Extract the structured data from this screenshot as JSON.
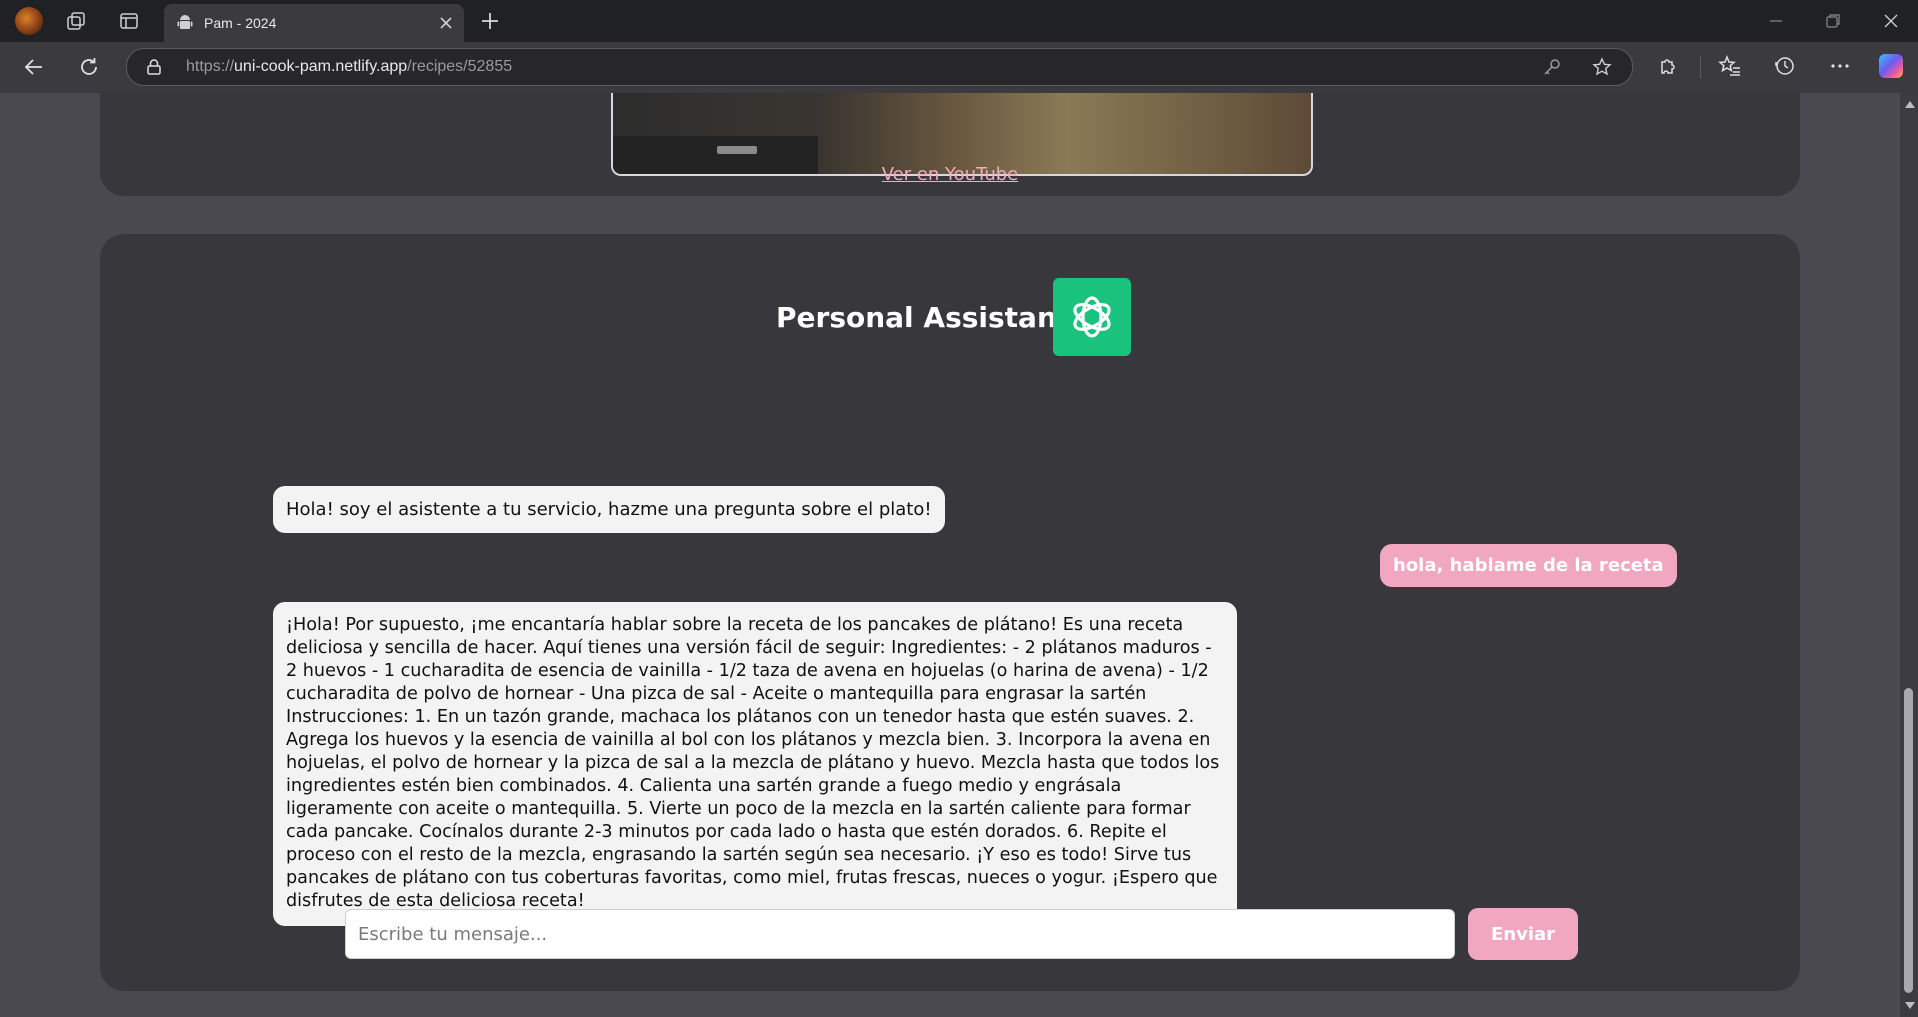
{
  "browser": {
    "tab_title": "Pam - 2024",
    "url_scheme": "https://",
    "url_host": "uni-cook-pam.netlify.app",
    "url_path": "/recipes/52855"
  },
  "video": {
    "youtube_link": "Ver en YouTube"
  },
  "chat": {
    "title": "Personal Assistant",
    "messages": [
      {
        "role": "assistant",
        "text": "Hola! soy el asistente a tu servicio, hazme una pregunta sobre el plato!"
      },
      {
        "role": "user",
        "text": "hola, hablame de la receta"
      },
      {
        "role": "assistant",
        "text": "¡Hola! Por supuesto, ¡me encantaría hablar sobre la receta de los pancakes de plátano! Es una receta deliciosa y sencilla de hacer. Aquí tienes una versión fácil de seguir: Ingredientes: - 2 plátanos maduros - 2 huevos - 1 cucharadita de esencia de vainilla - 1/2 taza de avena en hojuelas (o harina de avena) - 1/2 cucharadita de polvo de hornear - Una pizca de sal - Aceite o mantequilla para engrasar la sartén Instrucciones: 1. En un tazón grande, machaca los plátanos con un tenedor hasta que estén suaves. 2. Agrega los huevos y la esencia de vainilla al bol con los plátanos y mezcla bien. 3. Incorpora la avena en hojuelas, el polvo de hornear y la pizca de sal a la mezcla de plátano y huevo. Mezcla hasta que todos los ingredientes estén bien combinados. 4. Calienta una sartén grande a fuego medio y engrásala ligeramente con aceite o mantequilla. 5. Vierte un poco de la mezcla en la sartén caliente para formar cada pancake. Cocínalos durante 2-3 minutos por cada lado o hasta que estén dorados. 6. Repite el proceso con el resto de la mezcla, engrasando la sartén según sea necesario. ¡Y eso es todo! Sirve tus pancakes de plátano con tus coberturas favoritas, como miel, frutas frescas, nueces o yogur. ¡Espero que disfrutes de esta deliciosa receta!"
      }
    ],
    "input_placeholder": "Escribe tu mensaje...",
    "send_label": "Enviar"
  },
  "colors": {
    "page_bg": "#4a4950",
    "card_bg": "#38373c",
    "accent_pink": "#f1a7bf",
    "link_pink": "#f4a9c4",
    "chatgpt_green": "#19c37d"
  },
  "icons": {
    "profile": "profile-avatar",
    "workspaces": "workspaces-icon",
    "tab_actions": "vertical-tabs-icon",
    "tab_favicon": "android-icon",
    "back": "back-arrow-icon",
    "refresh": "refresh-icon",
    "lock": "lock-icon",
    "key": "key-icon",
    "favorite": "star-icon",
    "extensions": "puzzle-icon",
    "favorites": "favorites-icon",
    "history": "history-icon",
    "more": "more-icon",
    "copilot": "copilot-icon",
    "assistant_logo": "chatgpt-logo-icon"
  }
}
